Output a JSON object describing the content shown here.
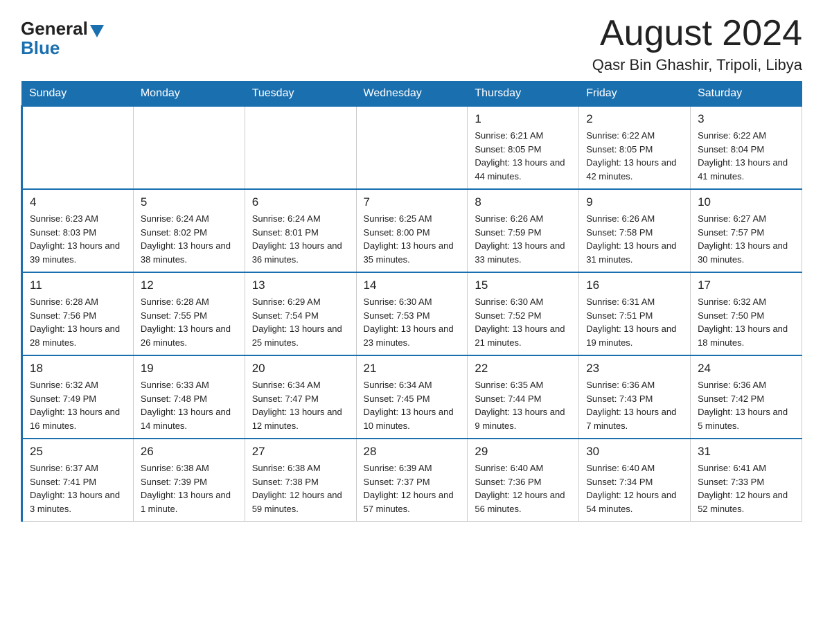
{
  "header": {
    "logo_general": "General",
    "logo_blue": "Blue",
    "month_title": "August 2024",
    "location": "Qasr Bin Ghashir, Tripoli, Libya"
  },
  "days_of_week": [
    "Sunday",
    "Monday",
    "Tuesday",
    "Wednesday",
    "Thursday",
    "Friday",
    "Saturday"
  ],
  "weeks": [
    [
      {
        "day": "",
        "info": ""
      },
      {
        "day": "",
        "info": ""
      },
      {
        "day": "",
        "info": ""
      },
      {
        "day": "",
        "info": ""
      },
      {
        "day": "1",
        "info": "Sunrise: 6:21 AM\nSunset: 8:05 PM\nDaylight: 13 hours and 44 minutes."
      },
      {
        "day": "2",
        "info": "Sunrise: 6:22 AM\nSunset: 8:05 PM\nDaylight: 13 hours and 42 minutes."
      },
      {
        "day": "3",
        "info": "Sunrise: 6:22 AM\nSunset: 8:04 PM\nDaylight: 13 hours and 41 minutes."
      }
    ],
    [
      {
        "day": "4",
        "info": "Sunrise: 6:23 AM\nSunset: 8:03 PM\nDaylight: 13 hours and 39 minutes."
      },
      {
        "day": "5",
        "info": "Sunrise: 6:24 AM\nSunset: 8:02 PM\nDaylight: 13 hours and 38 minutes."
      },
      {
        "day": "6",
        "info": "Sunrise: 6:24 AM\nSunset: 8:01 PM\nDaylight: 13 hours and 36 minutes."
      },
      {
        "day": "7",
        "info": "Sunrise: 6:25 AM\nSunset: 8:00 PM\nDaylight: 13 hours and 35 minutes."
      },
      {
        "day": "8",
        "info": "Sunrise: 6:26 AM\nSunset: 7:59 PM\nDaylight: 13 hours and 33 minutes."
      },
      {
        "day": "9",
        "info": "Sunrise: 6:26 AM\nSunset: 7:58 PM\nDaylight: 13 hours and 31 minutes."
      },
      {
        "day": "10",
        "info": "Sunrise: 6:27 AM\nSunset: 7:57 PM\nDaylight: 13 hours and 30 minutes."
      }
    ],
    [
      {
        "day": "11",
        "info": "Sunrise: 6:28 AM\nSunset: 7:56 PM\nDaylight: 13 hours and 28 minutes."
      },
      {
        "day": "12",
        "info": "Sunrise: 6:28 AM\nSunset: 7:55 PM\nDaylight: 13 hours and 26 minutes."
      },
      {
        "day": "13",
        "info": "Sunrise: 6:29 AM\nSunset: 7:54 PM\nDaylight: 13 hours and 25 minutes."
      },
      {
        "day": "14",
        "info": "Sunrise: 6:30 AM\nSunset: 7:53 PM\nDaylight: 13 hours and 23 minutes."
      },
      {
        "day": "15",
        "info": "Sunrise: 6:30 AM\nSunset: 7:52 PM\nDaylight: 13 hours and 21 minutes."
      },
      {
        "day": "16",
        "info": "Sunrise: 6:31 AM\nSunset: 7:51 PM\nDaylight: 13 hours and 19 minutes."
      },
      {
        "day": "17",
        "info": "Sunrise: 6:32 AM\nSunset: 7:50 PM\nDaylight: 13 hours and 18 minutes."
      }
    ],
    [
      {
        "day": "18",
        "info": "Sunrise: 6:32 AM\nSunset: 7:49 PM\nDaylight: 13 hours and 16 minutes."
      },
      {
        "day": "19",
        "info": "Sunrise: 6:33 AM\nSunset: 7:48 PM\nDaylight: 13 hours and 14 minutes."
      },
      {
        "day": "20",
        "info": "Sunrise: 6:34 AM\nSunset: 7:47 PM\nDaylight: 13 hours and 12 minutes."
      },
      {
        "day": "21",
        "info": "Sunrise: 6:34 AM\nSunset: 7:45 PM\nDaylight: 13 hours and 10 minutes."
      },
      {
        "day": "22",
        "info": "Sunrise: 6:35 AM\nSunset: 7:44 PM\nDaylight: 13 hours and 9 minutes."
      },
      {
        "day": "23",
        "info": "Sunrise: 6:36 AM\nSunset: 7:43 PM\nDaylight: 13 hours and 7 minutes."
      },
      {
        "day": "24",
        "info": "Sunrise: 6:36 AM\nSunset: 7:42 PM\nDaylight: 13 hours and 5 minutes."
      }
    ],
    [
      {
        "day": "25",
        "info": "Sunrise: 6:37 AM\nSunset: 7:41 PM\nDaylight: 13 hours and 3 minutes."
      },
      {
        "day": "26",
        "info": "Sunrise: 6:38 AM\nSunset: 7:39 PM\nDaylight: 13 hours and 1 minute."
      },
      {
        "day": "27",
        "info": "Sunrise: 6:38 AM\nSunset: 7:38 PM\nDaylight: 12 hours and 59 minutes."
      },
      {
        "day": "28",
        "info": "Sunrise: 6:39 AM\nSunset: 7:37 PM\nDaylight: 12 hours and 57 minutes."
      },
      {
        "day": "29",
        "info": "Sunrise: 6:40 AM\nSunset: 7:36 PM\nDaylight: 12 hours and 56 minutes."
      },
      {
        "day": "30",
        "info": "Sunrise: 6:40 AM\nSunset: 7:34 PM\nDaylight: 12 hours and 54 minutes."
      },
      {
        "day": "31",
        "info": "Sunrise: 6:41 AM\nSunset: 7:33 PM\nDaylight: 12 hours and 52 minutes."
      }
    ]
  ]
}
